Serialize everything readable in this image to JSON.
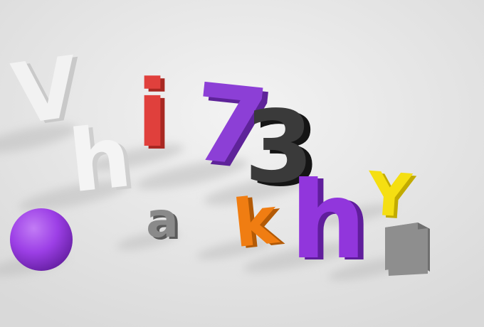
{
  "scene": {
    "background": "#eaeaea",
    "objects": [
      {
        "kind": "letter",
        "text": "V",
        "color": "#f2f2f2",
        "shade": "#c9c9c9",
        "rotate": -8
      },
      {
        "kind": "letter",
        "text": "h",
        "color": "#f4f4f4",
        "shade": "#cfcfcf",
        "rotate": -6
      },
      {
        "kind": "letter",
        "text": "i",
        "color": "#e0403c",
        "shade": "#a82822",
        "rotate": 0
      },
      {
        "kind": "letter",
        "text": "7",
        "color": "#8c3fd6",
        "shade": "#5e2399",
        "rotate": 6
      },
      {
        "kind": "letter",
        "text": "3",
        "color": "#3a3a3a",
        "shade": "#151515",
        "rotate": 0
      },
      {
        "kind": "letter",
        "text": "a",
        "color": "#8a8a8a",
        "shade": "#5a5a5a",
        "rotate": 0
      },
      {
        "kind": "letter",
        "text": "k",
        "color": "#f07d12",
        "shade": "#b35a06",
        "rotate": -6
      },
      {
        "kind": "letter",
        "text": "h",
        "color": "#9136dc",
        "shade": "#601e9c",
        "rotate": 0
      },
      {
        "kind": "letter",
        "text": "Y",
        "color": "#f5df12",
        "shade": "#c2ab00",
        "rotate": 4
      },
      {
        "kind": "sphere",
        "color": "#9c3fe6",
        "highlight": "#c27cf5",
        "shadow": "#6a22a8"
      },
      {
        "kind": "cube",
        "color": "#8e8e8e",
        "top": "#a3a3a3",
        "side": "#6f6f6f"
      }
    ]
  }
}
